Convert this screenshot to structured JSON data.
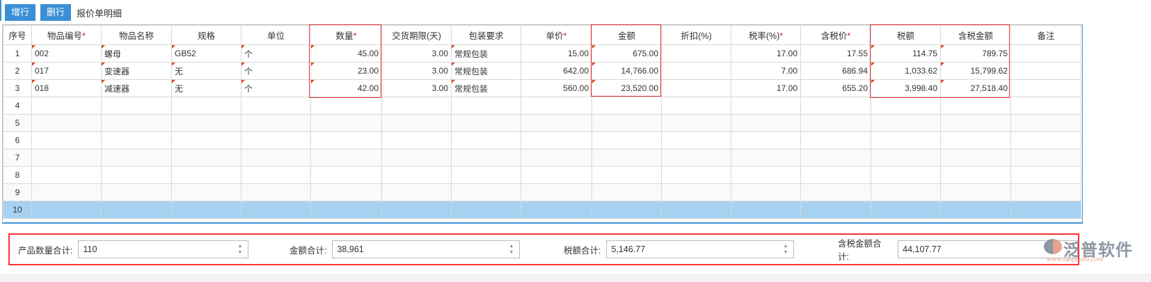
{
  "toolbar": {
    "add_row": "增行",
    "delete_row": "删行",
    "title": "报价单明细"
  },
  "columns": [
    {
      "label": "序号",
      "required": false,
      "w": 41
    },
    {
      "label": "物品编号",
      "required": true,
      "w": 100
    },
    {
      "label": "物品名称",
      "required": false,
      "w": 101
    },
    {
      "label": "规格",
      "required": false,
      "w": 100
    },
    {
      "label": "单位",
      "required": false,
      "w": 100
    },
    {
      "label": "数量",
      "required": true,
      "w": 102
    },
    {
      "label": "交货期限(天)",
      "required": false,
      "w": 100
    },
    {
      "label": "包装要求",
      "required": false,
      "w": 100
    },
    {
      "label": "单价",
      "required": true,
      "w": 102
    },
    {
      "label": "金额",
      "required": false,
      "w": 100
    },
    {
      "label": "折扣(%)",
      "required": false,
      "w": 100
    },
    {
      "label": "税率(%)",
      "required": true,
      "w": 100
    },
    {
      "label": "含税价",
      "required": true,
      "w": 101
    },
    {
      "label": "税额",
      "required": false,
      "w": 100
    },
    {
      "label": "含税金额",
      "required": false,
      "w": 101
    },
    {
      "label": "备注",
      "required": false,
      "w": 101
    }
  ],
  "rows": [
    [
      "1",
      "002",
      "螺母",
      "GB52",
      "个",
      "45.00",
      "3.00",
      "常规包装",
      "15.00",
      "675.00",
      "",
      "17.00",
      "17.55",
      "114.75",
      "789.75",
      ""
    ],
    [
      "2",
      "017",
      "变速器",
      "无",
      "个",
      "23.00",
      "3.00",
      "常规包装",
      "642.00",
      "14,766.00",
      "",
      "7.00",
      "686.94",
      "1,033.62",
      "15,799.62",
      ""
    ],
    [
      "3",
      "018",
      "减速器",
      "无",
      "个",
      "42.00",
      "3.00",
      "常规包装",
      "560.00",
      "23,520.00",
      "",
      "17.00",
      "655.20",
      "3,998.40",
      "27,518.40",
      ""
    ],
    [
      "4"
    ],
    [
      "5"
    ],
    [
      "6"
    ],
    [
      "7"
    ],
    [
      "8"
    ],
    [
      "9"
    ],
    [
      "10"
    ]
  ],
  "selected_row": "10",
  "footer": {
    "qty_label": "产品数量合计:",
    "qty_value": "110",
    "amount_label": "金额合计:",
    "amount_value": "38,961",
    "tax_label": "税额合计:",
    "tax_value": "5,146.77",
    "total_label": "含税金额合计:",
    "total_value": "44,107.77"
  },
  "logo": {
    "name": "泛普软件",
    "url": "www.fanpusoft.com"
  }
}
